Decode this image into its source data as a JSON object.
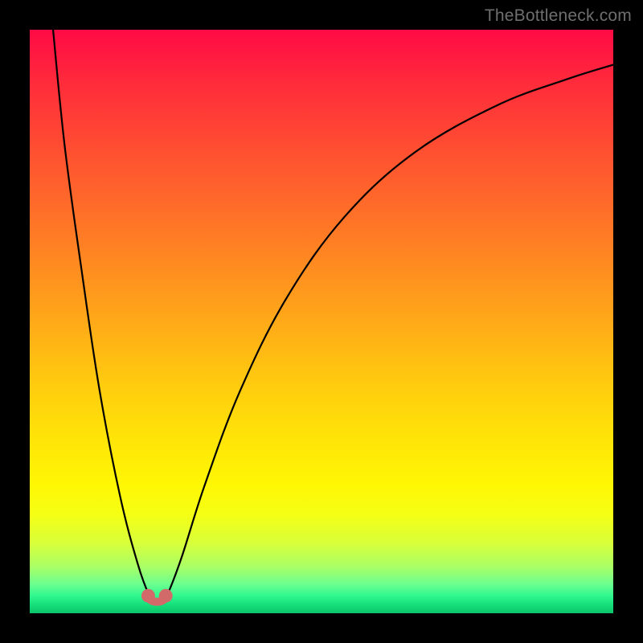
{
  "watermark": "TheBottleneck.com",
  "chart_data": {
    "type": "line",
    "title": "",
    "xlabel": "",
    "ylabel": "",
    "xlim": [
      0,
      100
    ],
    "ylim": [
      0,
      100
    ],
    "legend": false,
    "grid": false,
    "background": "gradient_red_to_green_vertical",
    "series": [
      {
        "name": "bottleneck-curve",
        "color": "#000000",
        "x": [
          4.0,
          6.0,
          9.0,
          12.0,
          15.5,
          18.5,
          20.5,
          21.5,
          22.5,
          23.5,
          26.0,
          30.0,
          36.0,
          44.0,
          54.0,
          66.0,
          80.0,
          92.0,
          100.0
        ],
        "values": [
          100,
          80,
          58,
          38,
          20,
          8.5,
          3.0,
          2.0,
          2.0,
          3.0,
          9.5,
          22.0,
          38.0,
          54.0,
          68.0,
          79.0,
          87.0,
          91.5,
          94.0
        ]
      },
      {
        "name": "marker-left",
        "type": "scatter",
        "color": "#d36a6a",
        "x": [
          20.3
        ],
        "values": [
          3.0
        ]
      },
      {
        "name": "marker-right",
        "type": "scatter",
        "color": "#d36a6a",
        "x": [
          23.3
        ],
        "values": [
          3.0
        ]
      }
    ],
    "annotations": []
  }
}
